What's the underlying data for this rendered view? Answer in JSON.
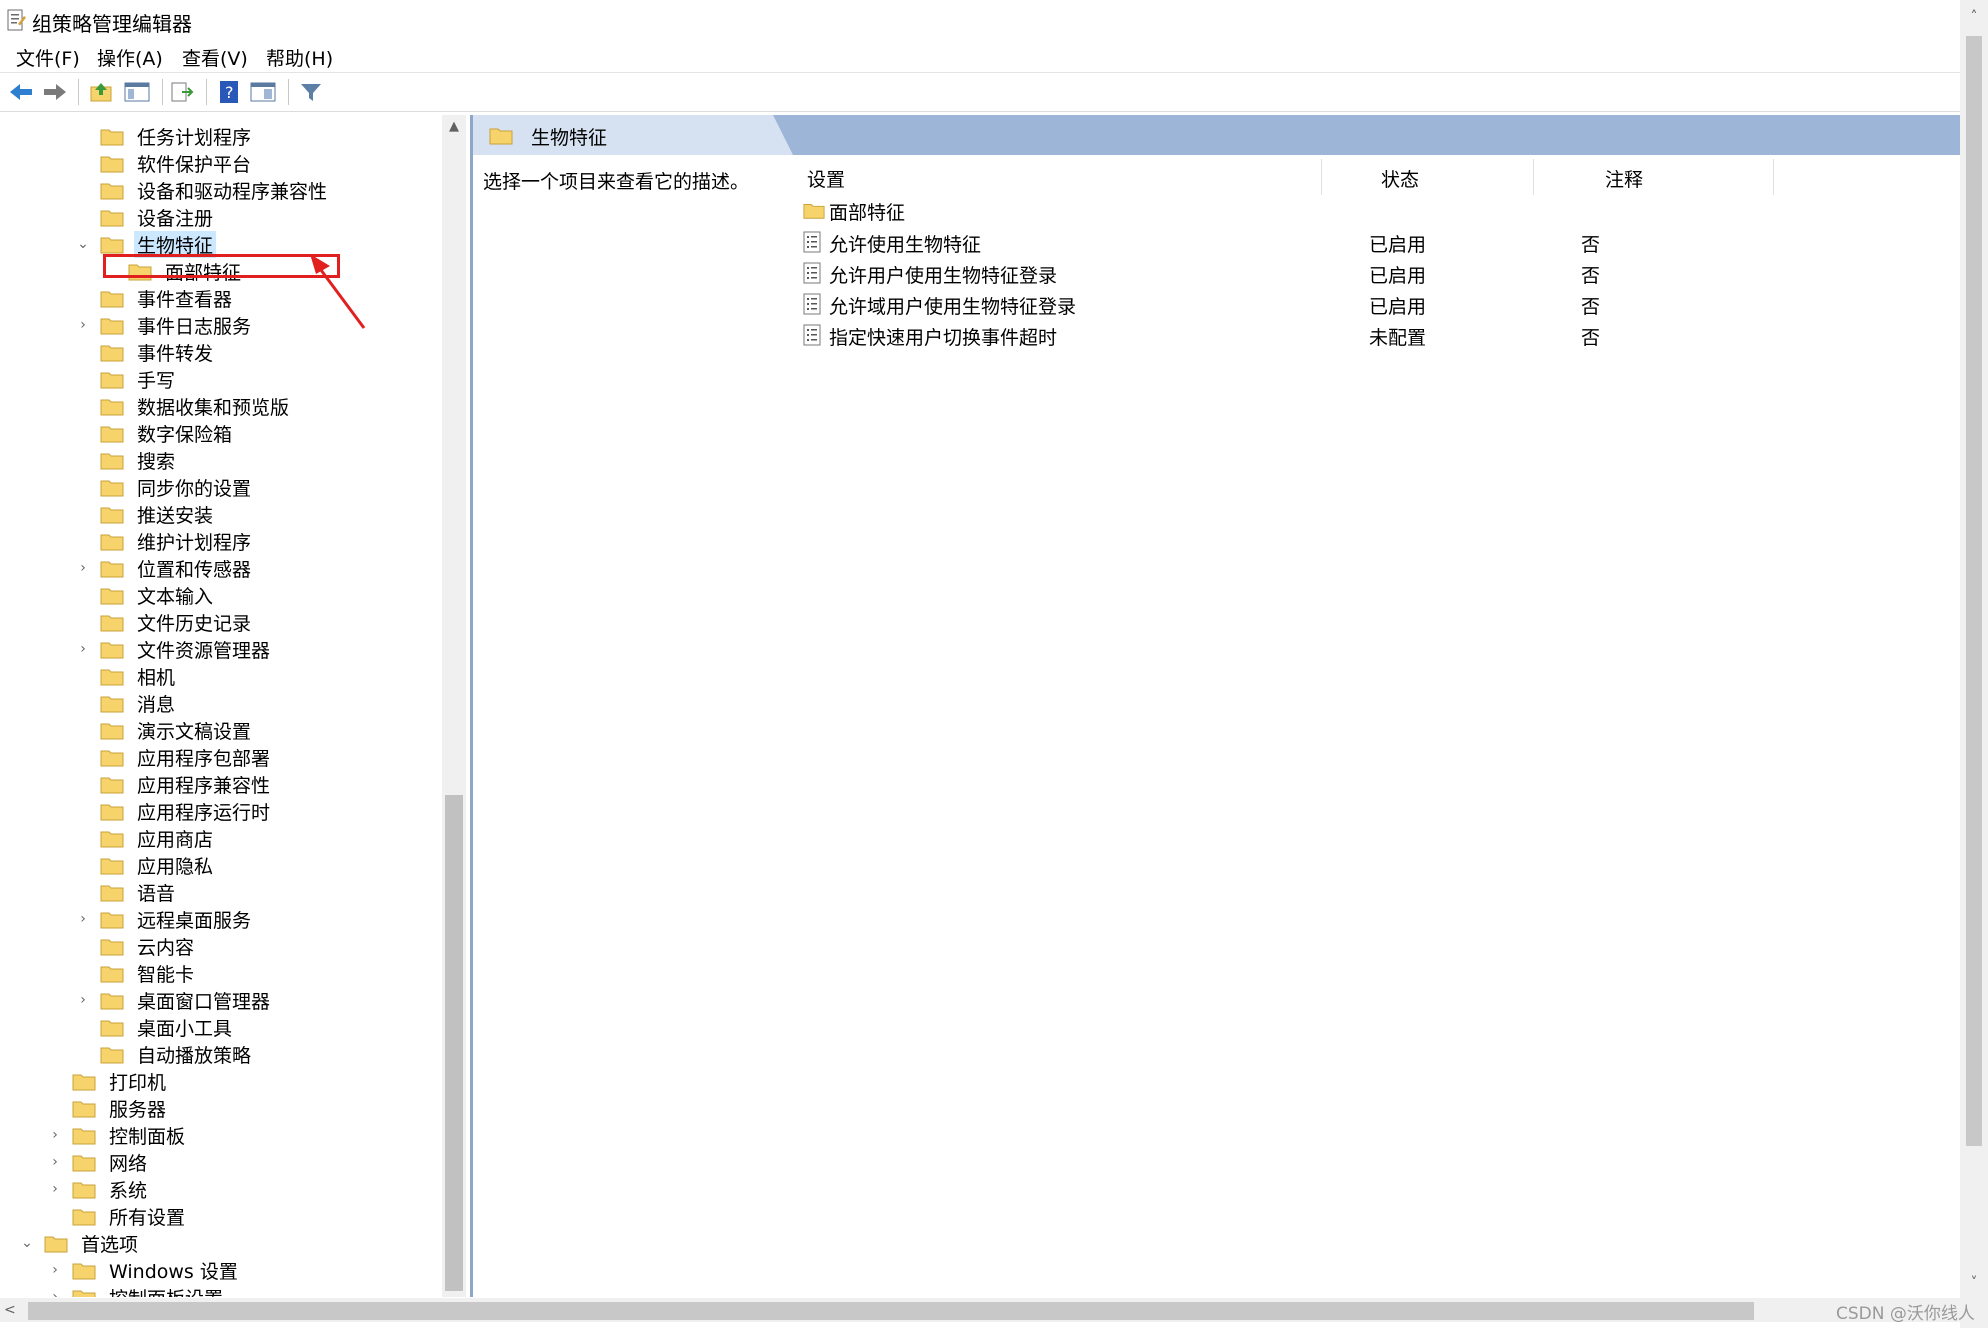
{
  "window": {
    "title": "组策略管理编辑器"
  },
  "menu": [
    "文件(F)",
    "操作(A)",
    "查看(V)",
    "帮助(H)"
  ],
  "toolbar": [
    "back-icon",
    "forward-icon",
    "up-folder-icon",
    "show-hide-tree-icon",
    "export-list-icon",
    "help-icon",
    "properties-icon",
    "filter-icon"
  ],
  "tree": {
    "items": [
      {
        "label": "任务计划程序",
        "expander": ""
      },
      {
        "label": "软件保护平台",
        "expander": ""
      },
      {
        "label": "设备和驱动程序兼容性",
        "expander": ""
      },
      {
        "label": "设备注册",
        "expander": ""
      },
      {
        "label": "生物特征",
        "expander": "v",
        "selected": true
      },
      {
        "label": "面部特征",
        "expander": ""
      },
      {
        "label": "事件查看器",
        "expander": ""
      },
      {
        "label": "事件日志服务",
        "expander": ">"
      },
      {
        "label": "事件转发",
        "expander": ""
      },
      {
        "label": "手写",
        "expander": ""
      },
      {
        "label": "数据收集和预览版",
        "expander": ""
      },
      {
        "label": "数字保险箱",
        "expander": ""
      },
      {
        "label": "搜索",
        "expander": ""
      },
      {
        "label": "同步你的设置",
        "expander": ""
      },
      {
        "label": "推送安装",
        "expander": ""
      },
      {
        "label": "维护计划程序",
        "expander": ""
      },
      {
        "label": "位置和传感器",
        "expander": ">"
      },
      {
        "label": "文本输入",
        "expander": ""
      },
      {
        "label": "文件历史记录",
        "expander": ""
      },
      {
        "label": "文件资源管理器",
        "expander": ">"
      },
      {
        "label": "相机",
        "expander": ""
      },
      {
        "label": "消息",
        "expander": ""
      },
      {
        "label": "演示文稿设置",
        "expander": ""
      },
      {
        "label": "应用程序包部署",
        "expander": ""
      },
      {
        "label": "应用程序兼容性",
        "expander": ""
      },
      {
        "label": "应用程序运行时",
        "expander": ""
      },
      {
        "label": "应用商店",
        "expander": ""
      },
      {
        "label": "应用隐私",
        "expander": ""
      },
      {
        "label": "语音",
        "expander": ""
      },
      {
        "label": "远程桌面服务",
        "expander": ">"
      },
      {
        "label": "云内容",
        "expander": ""
      },
      {
        "label": "智能卡",
        "expander": ""
      },
      {
        "label": "桌面窗口管理器",
        "expander": ">"
      },
      {
        "label": "桌面小工具",
        "expander": ""
      },
      {
        "label": "自动播放策略",
        "expander": ""
      },
      {
        "label": "打印机",
        "expander": ""
      },
      {
        "label": "服务器",
        "expander": ""
      },
      {
        "label": "控制面板",
        "expander": ">"
      },
      {
        "label": "网络",
        "expander": ">"
      },
      {
        "label": "系统",
        "expander": ">"
      },
      {
        "label": "所有设置",
        "expander": ""
      },
      {
        "label": "首选项",
        "expander": "v"
      },
      {
        "label": "Windows 设置",
        "expander": ">"
      },
      {
        "label": "控制面板设置",
        "expander": ">"
      }
    ]
  },
  "right": {
    "header_title": "生物特征",
    "description": "选择一个项目来查看它的描述。",
    "columns": {
      "setting": "设置",
      "state": "状态",
      "note": "注释"
    },
    "folder_row": "面部特征",
    "settings": [
      {
        "name": "允许使用生物特征",
        "state": "已启用",
        "note": "否"
      },
      {
        "name": "允许用户使用生物特征登录",
        "state": "已启用",
        "note": "否"
      },
      {
        "name": "允许域用户使用生物特征登录",
        "state": "已启用",
        "note": "否"
      },
      {
        "name": "指定快速用户切换事件超时",
        "state": "未配置",
        "note": "否"
      }
    ]
  },
  "watermark": "CSDN @沃你线人",
  "colors": {
    "selection": "#cce8ff",
    "header_bar": "#9db5d6",
    "annotation": "#e21f1f",
    "folder": "#f6d46b"
  }
}
